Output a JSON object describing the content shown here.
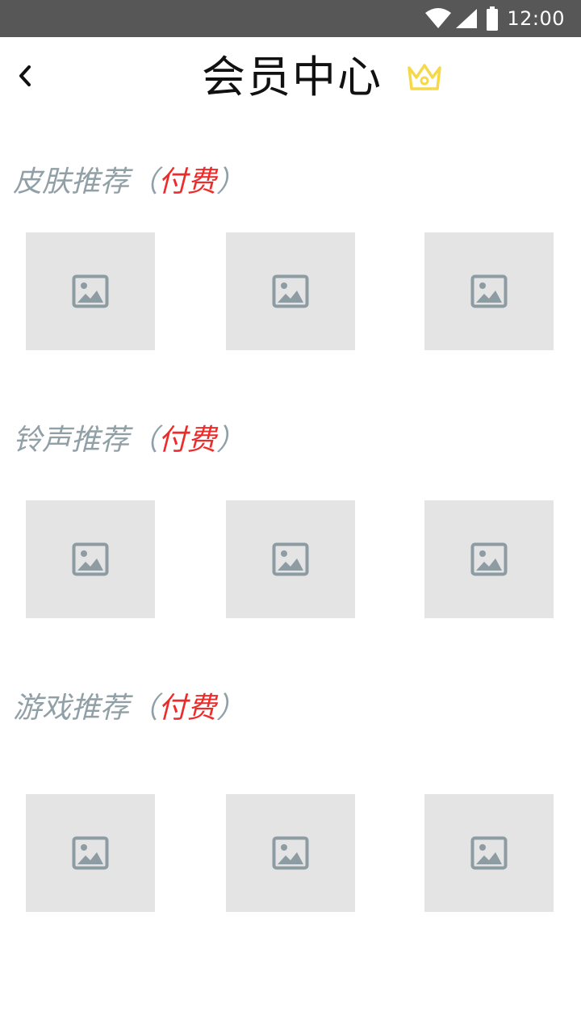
{
  "status_bar": {
    "time": "12:00",
    "icons": [
      "wifi-icon",
      "cellular-signal-icon",
      "battery-icon"
    ]
  },
  "header": {
    "back_icon": "chevron-left-icon",
    "title": "会员中心",
    "badge_icon": "crown-icon",
    "badge_color": "#f5d94a"
  },
  "sections": [
    {
      "label": "皮肤推荐",
      "open_paren": "（",
      "tag": "付费",
      "close_paren": "）",
      "items": [
        {
          "icon": "image-placeholder-icon"
        },
        {
          "icon": "image-placeholder-icon"
        },
        {
          "icon": "image-placeholder-icon"
        }
      ]
    },
    {
      "label": "铃声推荐",
      "open_paren": "（",
      "tag": "付费",
      "close_paren": "）",
      "items": [
        {
          "icon": "image-placeholder-icon"
        },
        {
          "icon": "image-placeholder-icon"
        },
        {
          "icon": "image-placeholder-icon"
        }
      ]
    },
    {
      "label": "游戏推荐",
      "open_paren": "（",
      "tag": "付费",
      "close_paren": "）",
      "items": [
        {
          "icon": "image-placeholder-icon"
        },
        {
          "icon": "image-placeholder-icon"
        },
        {
          "icon": "image-placeholder-icon"
        }
      ]
    }
  ],
  "colors": {
    "status_bar_bg": "#575757",
    "section_label": "#91a0a7",
    "paid_tag": "#ee2a2a",
    "thumb_bg": "#e4e4e4",
    "placeholder_icon": "#8d9ba2"
  }
}
